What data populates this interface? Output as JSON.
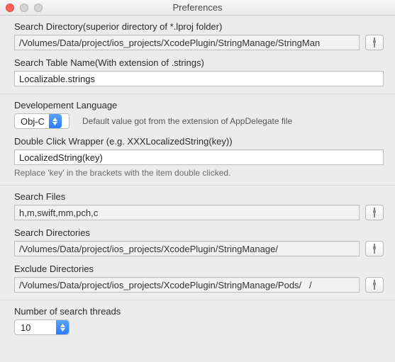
{
  "window": {
    "title": "Preferences"
  },
  "search_dir": {
    "label": "Search Directory(superior directory of *.lproj folder)",
    "value": "/Volumes/Data/project/ios_projects/XcodePlugin/StringManage/StringMan"
  },
  "table_name": {
    "label": "Search Table Name(With extension of .strings)",
    "value": "Localizable.strings"
  },
  "dev_lang": {
    "label": "Developement Language",
    "value": "Obj-C",
    "hint": "Default value got from the extension of AppDelegate file"
  },
  "wrapper": {
    "label": "Double Click Wrapper (e.g. XXXLocalizedString(key))",
    "value": "LocalizedString(key)",
    "hint": "Replace 'key' in the brackets with the item double clicked."
  },
  "search_files": {
    "label": "Search Files",
    "value": "h,m,swift,mm,pch,c"
  },
  "search_dirs": {
    "label": "Search Directories",
    "value": "/Volumes/Data/project/ios_projects/XcodePlugin/StringManage/"
  },
  "exclude_dirs": {
    "label": "Exclude Directories",
    "value": "/Volumes/Data/project/ios_projects/XcodePlugin/StringManage/Pods/   /"
  },
  "threads": {
    "label": "Number of search threads",
    "value": "10"
  }
}
